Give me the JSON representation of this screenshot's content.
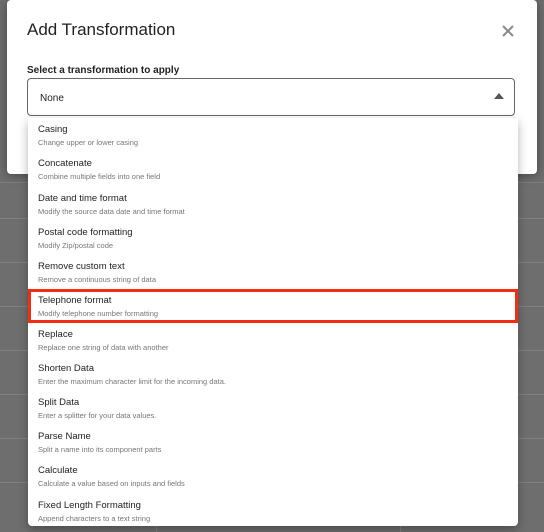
{
  "dialog": {
    "title": "Add Transformation",
    "close_icon": "close-icon",
    "field_label": "Select a transformation to apply",
    "selected_value": "None",
    "caret_icon": "caret-up-icon"
  },
  "options": [
    {
      "title": "Casing",
      "desc": "Change upper or lower casing"
    },
    {
      "title": "Concatenate",
      "desc": "Combine multiple fields into one field"
    },
    {
      "title": "Date and time format",
      "desc": "Modify the source data date and time format"
    },
    {
      "title": "Postal code formatting",
      "desc": "Modify Zip/postal code"
    },
    {
      "title": "Remove custom text",
      "desc": "Remove a continuous string of data"
    },
    {
      "title": "Telephone format",
      "desc": "Modify telephone number formatting"
    },
    {
      "title": "Replace",
      "desc": "Replace one string of data with another"
    },
    {
      "title": "Shorten Data",
      "desc": "Enter the maximum character limit for the incoming data."
    },
    {
      "title": "Split Data",
      "desc": "Enter a splitter for your data values."
    },
    {
      "title": "Parse Name",
      "desc": "Split a name into its component parts"
    },
    {
      "title": "Calculate",
      "desc": "Calculate a value based on inputs and fields"
    },
    {
      "title": "Fixed Length Formatting",
      "desc": "Append characters to a text string"
    }
  ],
  "colors": {
    "highlight_border": "#f12d12",
    "overlay": "#6e6e6e"
  }
}
